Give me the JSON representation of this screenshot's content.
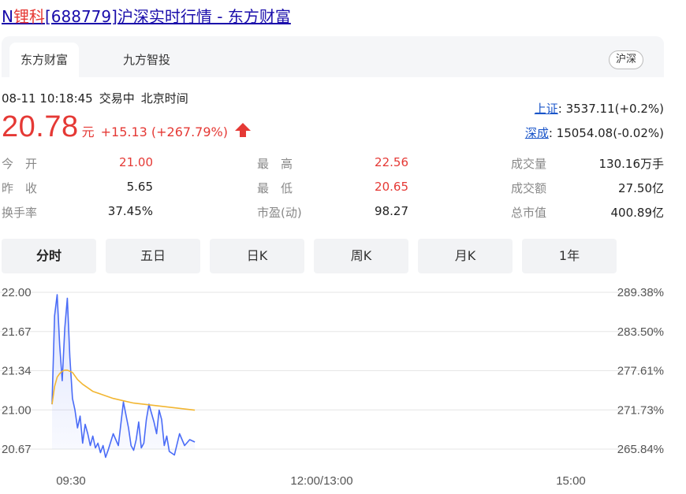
{
  "page": {
    "title_prefix": "N",
    "title_highlight": "锂科",
    "title_rest": "[688779]沪深实时行情 - 东方财富"
  },
  "tabs": [
    {
      "label": "东方财富",
      "active": true
    },
    {
      "label": "九方智投",
      "active": false
    }
  ],
  "market_badge": "沪深",
  "status": {
    "datetime": "08-11 10:18:45",
    "state": "交易中",
    "timezone": "北京时间"
  },
  "price": {
    "value": "20.78",
    "unit": "元",
    "change": "+15.13 (+267.79%)",
    "direction": "up",
    "color": "#e53935"
  },
  "indices": [
    {
      "name": "上证",
      "value": ": 3537.11(+0.2%)"
    },
    {
      "name": "深成",
      "value": ": 15054.08(-0.02%)"
    }
  ],
  "stats": [
    [
      {
        "label": "今　开",
        "value": "21.00",
        "red": true
      },
      {
        "label": "最　高",
        "value": "22.56",
        "red": true
      },
      {
        "label": "成交量",
        "value": "130.16万手",
        "red": false
      }
    ],
    [
      {
        "label": "昨　收",
        "value": "5.65",
        "red": false
      },
      {
        "label": "最　低",
        "value": "20.65",
        "red": true
      },
      {
        "label": "成交额",
        "value": "27.50亿",
        "red": false
      }
    ],
    [
      {
        "label": "换手率",
        "value": "37.45%",
        "red": false
      },
      {
        "label": "市盈(动)",
        "value": "98.27",
        "red": false
      },
      {
        "label": "总市值",
        "value": "400.89亿",
        "red": false
      }
    ]
  ],
  "periods": [
    "分时",
    "五日",
    "日K",
    "周K",
    "月K",
    "1年"
  ],
  "active_period": "分时",
  "chart_data": {
    "type": "line",
    "y_left_ticks": [
      "22.00",
      "21.67",
      "21.34",
      "21.00",
      "20.67"
    ],
    "y_right_ticks": [
      "289.38%",
      "283.50%",
      "277.61%",
      "271.73%",
      "265.84%"
    ],
    "x_ticks": [
      "09:30",
      "12:00/13:00",
      "15:00"
    ],
    "ylim": [
      20.67,
      22.0
    ],
    "x_range_minutes": [
      0,
      240
    ],
    "grid": true,
    "series": [
      {
        "color": "#4a6cf7",
        "x": [
          0,
          1,
          2,
          3,
          4,
          5,
          6,
          7,
          8,
          9,
          10,
          11,
          12,
          13,
          14,
          15,
          16,
          17,
          18,
          19,
          20,
          21,
          22,
          24,
          26,
          28,
          30,
          31,
          32,
          33,
          34,
          35,
          36,
          37,
          38,
          40,
          41,
          42,
          43,
          44,
          45,
          46,
          48,
          50,
          52,
          54,
          56
        ],
        "y": [
          21.05,
          21.8,
          21.98,
          21.55,
          21.25,
          21.7,
          21.95,
          21.45,
          21.1,
          21.0,
          20.85,
          20.95,
          20.72,
          20.88,
          20.8,
          20.7,
          20.78,
          20.68,
          20.72,
          20.64,
          20.7,
          20.6,
          20.66,
          20.8,
          20.7,
          21.07,
          20.85,
          20.7,
          20.66,
          20.75,
          20.9,
          20.68,
          20.72,
          20.92,
          21.05,
          20.9,
          20.8,
          21.0,
          20.92,
          20.7,
          20.78,
          20.65,
          20.62,
          20.8,
          20.7,
          20.75,
          20.73
        ]
      },
      {
        "color": "#f2b632",
        "x": [
          0,
          1,
          2,
          3,
          4,
          5,
          6,
          8,
          10,
          12,
          14,
          16,
          20,
          24,
          28,
          32,
          36,
          40,
          44,
          48,
          52,
          56
        ],
        "y": [
          21.05,
          21.2,
          21.28,
          21.31,
          21.33,
          21.34,
          21.34,
          21.32,
          21.26,
          21.22,
          21.19,
          21.16,
          21.13,
          21.1,
          21.08,
          21.06,
          21.05,
          21.04,
          21.03,
          21.02,
          21.01,
          21.0
        ]
      }
    ]
  }
}
